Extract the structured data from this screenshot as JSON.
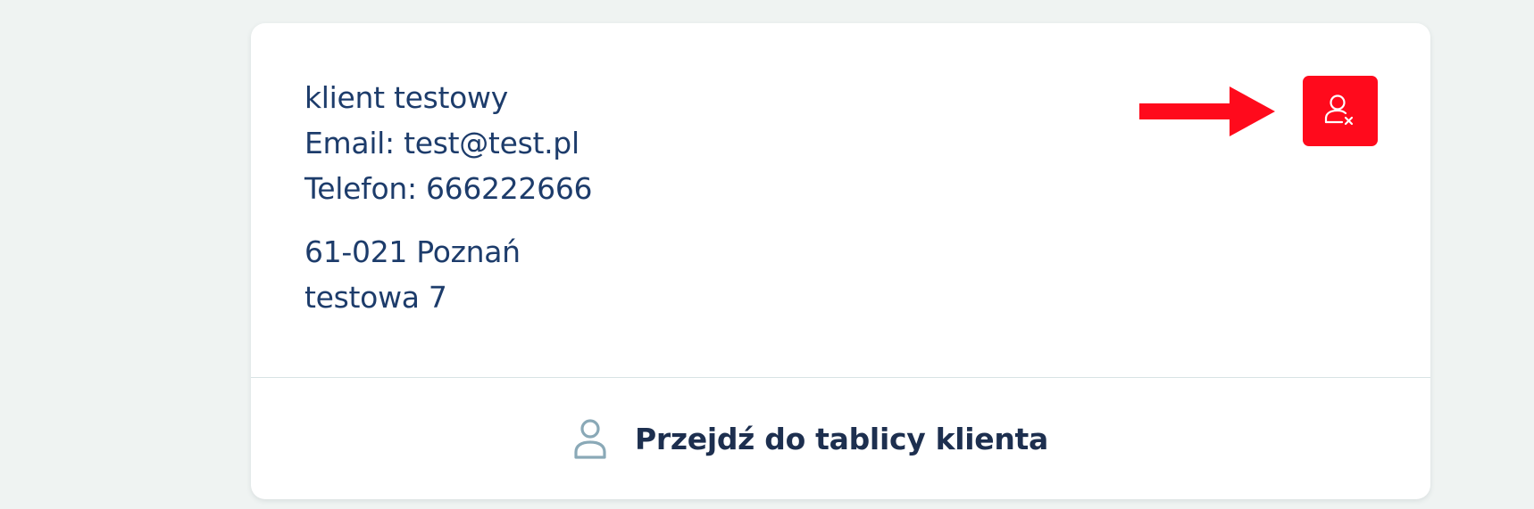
{
  "client": {
    "name": "klient testowy",
    "email": "Email: test@test.pl",
    "phone": "Telefon: 666222666",
    "postal_city": "61-021 Poznań",
    "street": "testowa 7"
  },
  "actions": {
    "remove_client_icon": "user-remove-icon",
    "go_to_board_label": "Przejdź do tablicy klienta",
    "go_to_board_icon": "user-icon"
  },
  "colors": {
    "accent_red": "#ff0a1c",
    "text_primary": "#1d3c6b",
    "icon_muted": "#8aa9b7"
  }
}
